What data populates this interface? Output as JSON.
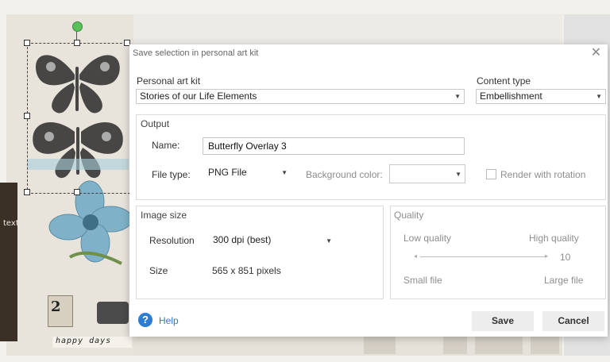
{
  "dialog": {
    "title": "Save selection in personal art kit",
    "close_glyph": "✕",
    "kit": {
      "label": "Personal art kit",
      "value": "Stories of our Life Elements"
    },
    "content_type": {
      "label": "Content type",
      "value": "Embellishment"
    },
    "output": {
      "title": "Output",
      "name_label": "Name:",
      "name_value": "Butterfly Overlay 3",
      "filetype_label": "File type:",
      "filetype_value": "PNG File",
      "bgcolor_label": "Background color:",
      "bgcolor_value": "",
      "render_rotation_label": "Render with rotation",
      "render_rotation_checked": false
    },
    "image_size": {
      "title": "Image size",
      "resolution_label": "Resolution",
      "resolution_value": "300 dpi (best)",
      "size_label": "Size",
      "size_value": "565 x 851 pixels"
    },
    "quality": {
      "title": "Quality",
      "low_label": "Low quality",
      "high_label": "High quality",
      "value": "10",
      "level_fraction": 1.0,
      "small_label": "Small file",
      "large_label": "Large file"
    },
    "help_label": "Help",
    "save_label": "Save",
    "cancel_label": "Cancel"
  },
  "background": {
    "side_text": "text",
    "stamp_number": "2",
    "happy_text": "happy days"
  },
  "colors": {
    "accent_blue": "#2c7bd4",
    "selection_handle_green": "#5ac15a",
    "button_bg": "#ededed"
  }
}
